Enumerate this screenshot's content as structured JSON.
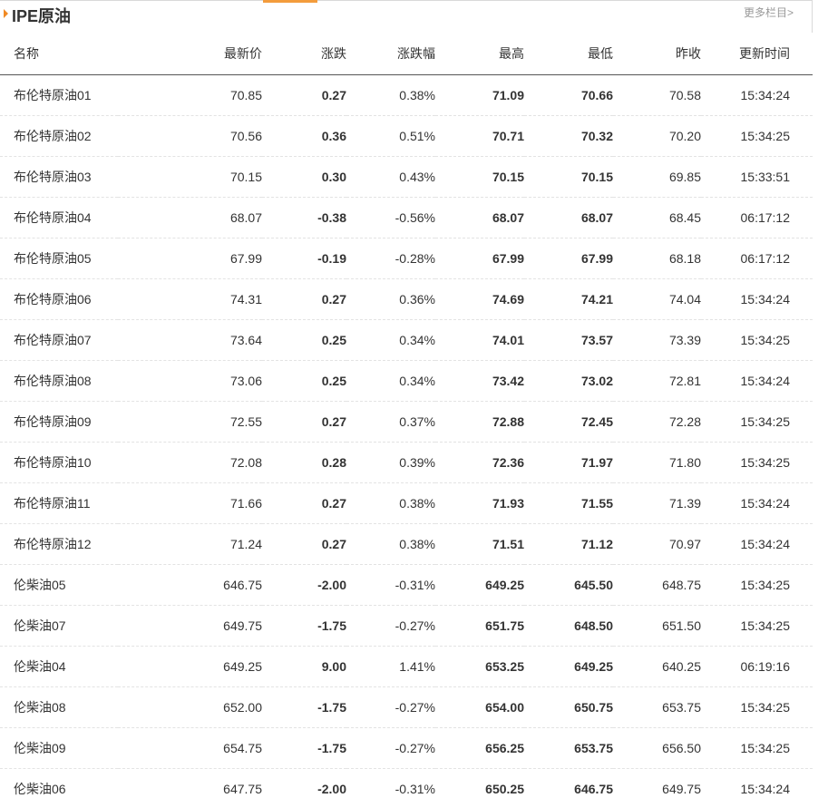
{
  "header": {
    "title": "IPE原油",
    "more_link": "更多栏目>"
  },
  "colors": {
    "up": "#e04848",
    "down": "#2ea073",
    "accent": "#f39c3c"
  },
  "table": {
    "columns": [
      "名称",
      "最新价",
      "涨跌",
      "涨跌幅",
      "最高",
      "最低",
      "昨收",
      "更新时间"
    ],
    "rows": [
      {
        "name": "布伦特原油01",
        "last": "70.85",
        "change": "0.27",
        "pct": "0.38%",
        "high": "71.09",
        "low": "70.66",
        "prev": "70.58",
        "time": "15:34:24",
        "dir": "up"
      },
      {
        "name": "布伦特原油02",
        "last": "70.56",
        "change": "0.36",
        "pct": "0.51%",
        "high": "70.71",
        "low": "70.32",
        "prev": "70.20",
        "time": "15:34:25",
        "dir": "up"
      },
      {
        "name": "布伦特原油03",
        "last": "70.15",
        "change": "0.30",
        "pct": "0.43%",
        "high": "70.15",
        "low": "70.15",
        "prev": "69.85",
        "time": "15:33:51",
        "dir": "up"
      },
      {
        "name": "布伦特原油04",
        "last": "68.07",
        "change": "-0.38",
        "pct": "-0.56%",
        "high": "68.07",
        "low": "68.07",
        "prev": "68.45",
        "time": "06:17:12",
        "dir": "down"
      },
      {
        "name": "布伦特原油05",
        "last": "67.99",
        "change": "-0.19",
        "pct": "-0.28%",
        "high": "67.99",
        "low": "67.99",
        "prev": "68.18",
        "time": "06:17:12",
        "dir": "down"
      },
      {
        "name": "布伦特原油06",
        "last": "74.31",
        "change": "0.27",
        "pct": "0.36%",
        "high": "74.69",
        "low": "74.21",
        "prev": "74.04",
        "time": "15:34:24",
        "dir": "up"
      },
      {
        "name": "布伦特原油07",
        "last": "73.64",
        "change": "0.25",
        "pct": "0.34%",
        "high": "74.01",
        "low": "73.57",
        "prev": "73.39",
        "time": "15:34:25",
        "dir": "up"
      },
      {
        "name": "布伦特原油08",
        "last": "73.06",
        "change": "0.25",
        "pct": "0.34%",
        "high": "73.42",
        "low": "73.02",
        "prev": "72.81",
        "time": "15:34:24",
        "dir": "up"
      },
      {
        "name": "布伦特原油09",
        "last": "72.55",
        "change": "0.27",
        "pct": "0.37%",
        "high": "72.88",
        "low": "72.45",
        "prev": "72.28",
        "time": "15:34:25",
        "dir": "up"
      },
      {
        "name": "布伦特原油10",
        "last": "72.08",
        "change": "0.28",
        "pct": "0.39%",
        "high": "72.36",
        "low": "71.97",
        "prev": "71.80",
        "time": "15:34:25",
        "dir": "up"
      },
      {
        "name": "布伦特原油11",
        "last": "71.66",
        "change": "0.27",
        "pct": "0.38%",
        "high": "71.93",
        "low": "71.55",
        "prev": "71.39",
        "time": "15:34:24",
        "dir": "up"
      },
      {
        "name": "布伦特原油12",
        "last": "71.24",
        "change": "0.27",
        "pct": "0.38%",
        "high": "71.51",
        "low": "71.12",
        "prev": "70.97",
        "time": "15:34:24",
        "dir": "up"
      },
      {
        "name": "伦柴油05",
        "last": "646.75",
        "change": "-2.00",
        "pct": "-0.31%",
        "high": "649.25",
        "low": "645.50",
        "prev": "648.75",
        "time": "15:34:25",
        "dir": "down"
      },
      {
        "name": "伦柴油07",
        "last": "649.75",
        "change": "-1.75",
        "pct": "-0.27%",
        "high": "651.75",
        "low": "648.50",
        "prev": "651.50",
        "time": "15:34:25",
        "dir": "down"
      },
      {
        "name": "伦柴油04",
        "last": "649.25",
        "change": "9.00",
        "pct": "1.41%",
        "high": "653.25",
        "low": "649.25",
        "prev": "640.25",
        "time": "06:19:16",
        "dir": "up"
      },
      {
        "name": "伦柴油08",
        "last": "652.00",
        "change": "-1.75",
        "pct": "-0.27%",
        "high": "654.00",
        "low": "650.75",
        "prev": "653.75",
        "time": "15:34:25",
        "dir": "down"
      },
      {
        "name": "伦柴油09",
        "last": "654.75",
        "change": "-1.75",
        "pct": "-0.27%",
        "high": "656.25",
        "low": "653.75",
        "prev": "656.50",
        "time": "15:34:25",
        "dir": "down"
      },
      {
        "name": "伦柴油06",
        "last": "647.75",
        "change": "-2.00",
        "pct": "-0.31%",
        "high": "650.25",
        "low": "646.75",
        "prev": "649.75",
        "time": "15:34:24",
        "dir": "down"
      }
    ]
  }
}
